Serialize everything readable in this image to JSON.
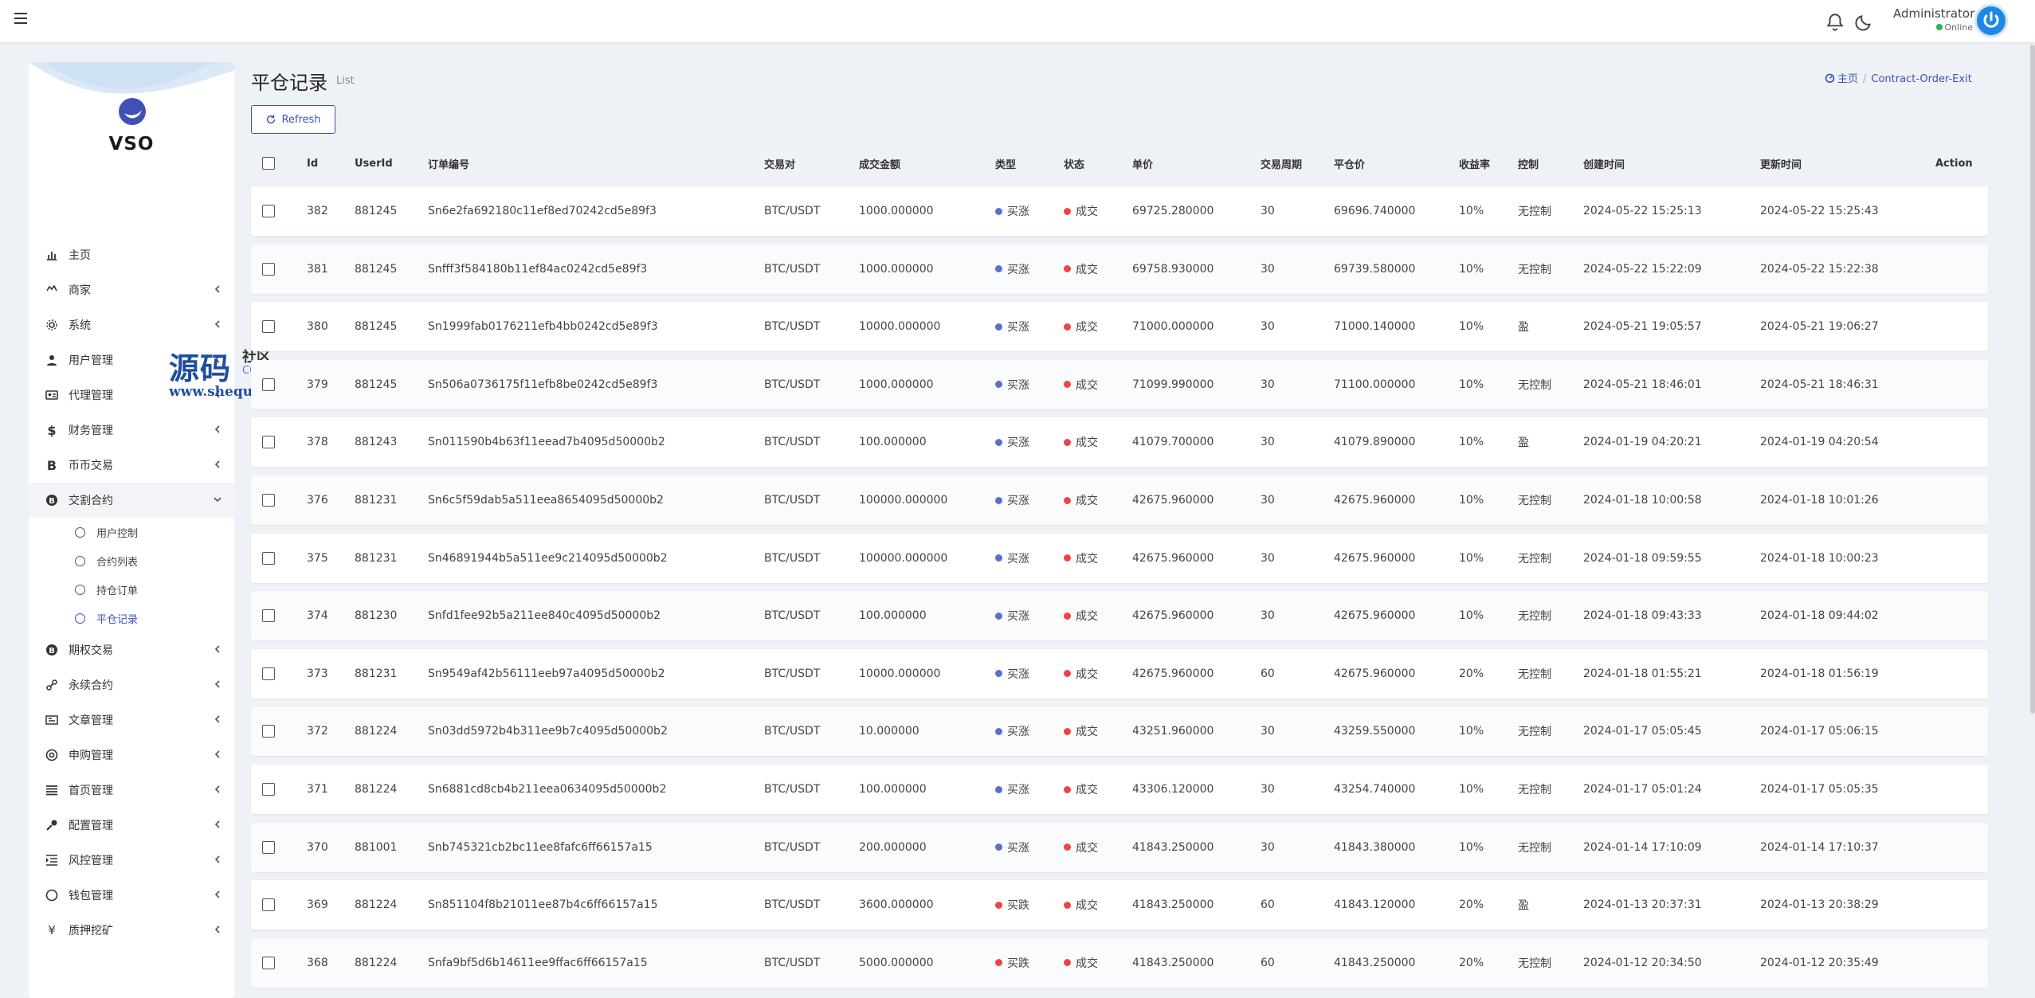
{
  "header": {
    "admin_name": "Administrator",
    "admin_status": "Online"
  },
  "sidebar": {
    "logo": "VSO",
    "items": [
      {
        "label": "主页",
        "icon": "bar-chart-icon",
        "chevron": false
      },
      {
        "label": "商家",
        "icon": "ship-icon",
        "chevron": true
      },
      {
        "label": "系统",
        "icon": "gear-icon",
        "chevron": true
      },
      {
        "label": "用户管理",
        "icon": "user-icon",
        "chevron": true
      },
      {
        "label": "代理管理",
        "icon": "id-card-icon",
        "chevron": true
      },
      {
        "label": "财务管理",
        "icon": "dollar-icon",
        "chevron": true
      },
      {
        "label": "币币交易",
        "icon": "bitcoin-icon",
        "chevron": true
      },
      {
        "label": "交割合约",
        "icon": "bitcoin-circle-icon",
        "chevron": true,
        "open": true
      },
      {
        "label": "期权交易",
        "icon": "bitcoin-circle-icon",
        "chevron": true
      },
      {
        "label": "永续合约",
        "icon": "link-icon",
        "chevron": true
      },
      {
        "label": "文章管理",
        "icon": "newspaper-icon",
        "chevron": true
      },
      {
        "label": "申购管理",
        "icon": "lifebuoy-icon",
        "chevron": true
      },
      {
        "label": "首页管理",
        "icon": "list-icon",
        "chevron": true
      },
      {
        "label": "配置管理",
        "icon": "wrench-icon",
        "chevron": true
      },
      {
        "label": "风控管理",
        "icon": "indent-icon",
        "chevron": true
      },
      {
        "label": "钱包管理",
        "icon": "circle-icon",
        "chevron": true
      },
      {
        "label": "质押挖矿",
        "icon": "yen-icon",
        "chevron": true
      }
    ],
    "subitems": [
      "用户控制",
      "合约列表",
      "持仓订单",
      "平仓记录"
    ],
    "active_subitem": 3
  },
  "watermark": {
    "main": "源码",
    "sub": "社区",
    "community": "COMMUNITY",
    "url": "www.shequym.com"
  },
  "page": {
    "title": "平仓记录",
    "subtitle": "List",
    "breadcrumb_home": "主页",
    "breadcrumb_current": "Contract-Order-Exit",
    "refresh_label": "Refresh"
  },
  "table": {
    "columns": [
      "Id",
      "UserId",
      "订单编号",
      "交易对",
      "成交金额",
      "类型",
      "状态",
      "单价",
      "交易周期",
      "平仓价",
      "收益率",
      "控制",
      "创建时间",
      "更新时间",
      "Action"
    ],
    "rows": [
      [
        "382",
        "881245",
        "Sn6e2fa692180c11ef8ed70242cd5e89f3",
        "BTC/USDT",
        "1000.000000",
        "买涨",
        "成交",
        "69725.280000",
        "30",
        "69696.740000",
        "10%",
        "无控制",
        "2024-05-22 15:25:13",
        "2024-05-22 15:25:43"
      ],
      [
        "381",
        "881245",
        "Snfff3f584180b11ef84ac0242cd5e89f3",
        "BTC/USDT",
        "1000.000000",
        "买涨",
        "成交",
        "69758.930000",
        "30",
        "69739.580000",
        "10%",
        "无控制",
        "2024-05-22 15:22:09",
        "2024-05-22 15:22:38"
      ],
      [
        "380",
        "881245",
        "Sn1999fab0176211efb4bb0242cd5e89f3",
        "BTC/USDT",
        "10000.000000",
        "买涨",
        "成交",
        "71000.000000",
        "30",
        "71000.140000",
        "10%",
        "盈",
        "2024-05-21 19:05:57",
        "2024-05-21 19:06:27"
      ],
      [
        "379",
        "881245",
        "Sn506a0736175f11efb8be0242cd5e89f3",
        "BTC/USDT",
        "1000.000000",
        "买涨",
        "成交",
        "71099.990000",
        "30",
        "71100.000000",
        "10%",
        "无控制",
        "2024-05-21 18:46:01",
        "2024-05-21 18:46:31"
      ],
      [
        "378",
        "881243",
        "Sn011590b4b63f11eead7b4095d50000b2",
        "BTC/USDT",
        "100.000000",
        "买涨",
        "成交",
        "41079.700000",
        "30",
        "41079.890000",
        "10%",
        "盈",
        "2024-01-19 04:20:21",
        "2024-01-19 04:20:54"
      ],
      [
        "376",
        "881231",
        "Sn6c5f59dab5a511eea8654095d50000b2",
        "BTC/USDT",
        "100000.000000",
        "买涨",
        "成交",
        "42675.960000",
        "30",
        "42675.960000",
        "10%",
        "无控制",
        "2024-01-18 10:00:58",
        "2024-01-18 10:01:26"
      ],
      [
        "375",
        "881231",
        "Sn46891944b5a511ee9c214095d50000b2",
        "BTC/USDT",
        "100000.000000",
        "买涨",
        "成交",
        "42675.960000",
        "30",
        "42675.960000",
        "10%",
        "无控制",
        "2024-01-18 09:59:55",
        "2024-01-18 10:00:23"
      ],
      [
        "374",
        "881230",
        "Snfd1fee92b5a211ee840c4095d50000b2",
        "BTC/USDT",
        "100.000000",
        "买涨",
        "成交",
        "42675.960000",
        "30",
        "42675.960000",
        "10%",
        "无控制",
        "2024-01-18 09:43:33",
        "2024-01-18 09:44:02"
      ],
      [
        "373",
        "881231",
        "Sn9549af42b56111eeb97a4095d50000b2",
        "BTC/USDT",
        "10000.000000",
        "买涨",
        "成交",
        "42675.960000",
        "60",
        "42675.960000",
        "20%",
        "无控制",
        "2024-01-18 01:55:21",
        "2024-01-18 01:56:19"
      ],
      [
        "372",
        "881224",
        "Sn03dd5972b4b311ee9b7c4095d50000b2",
        "BTC/USDT",
        "10.000000",
        "买涨",
        "成交",
        "43251.960000",
        "30",
        "43259.550000",
        "10%",
        "无控制",
        "2024-01-17 05:05:45",
        "2024-01-17 05:06:15"
      ],
      [
        "371",
        "881224",
        "Sn6881cd8cb4b211eea0634095d50000b2",
        "BTC/USDT",
        "100.000000",
        "买涨",
        "成交",
        "43306.120000",
        "30",
        "43254.740000",
        "10%",
        "无控制",
        "2024-01-17 05:01:24",
        "2024-01-17 05:05:35"
      ],
      [
        "370",
        "881001",
        "Snb745321cb2bc11ee8fafc6ff66157a15",
        "BTC/USDT",
        "200.000000",
        "买涨",
        "成交",
        "41843.250000",
        "30",
        "41843.380000",
        "10%",
        "无控制",
        "2024-01-14 17:10:09",
        "2024-01-14 17:10:37"
      ],
      [
        "369",
        "881224",
        "Sn851104f8b21011ee87b4c6ff66157a15",
        "BTC/USDT",
        "3600.000000",
        "买跌",
        "成交",
        "41843.250000",
        "60",
        "41843.120000",
        "20%",
        "盈",
        "2024-01-13 20:37:31",
        "2024-01-13 20:38:29"
      ],
      [
        "368",
        "881224",
        "Snfa9bf5d6b14611ee9ffac6ff66157a15",
        "BTC/USDT",
        "5000.000000",
        "买跌",
        "成交",
        "41843.250000",
        "60",
        "41843.250000",
        "20%",
        "无控制",
        "2024-01-12 20:34:50",
        "2024-01-12 20:35:49"
      ]
    ]
  },
  "colors": {
    "accent": "#3f51b5",
    "buy_up_dot": "#5b6ed6",
    "buy_down_dot": "#ef4444",
    "status_dot": "#ef4444"
  }
}
